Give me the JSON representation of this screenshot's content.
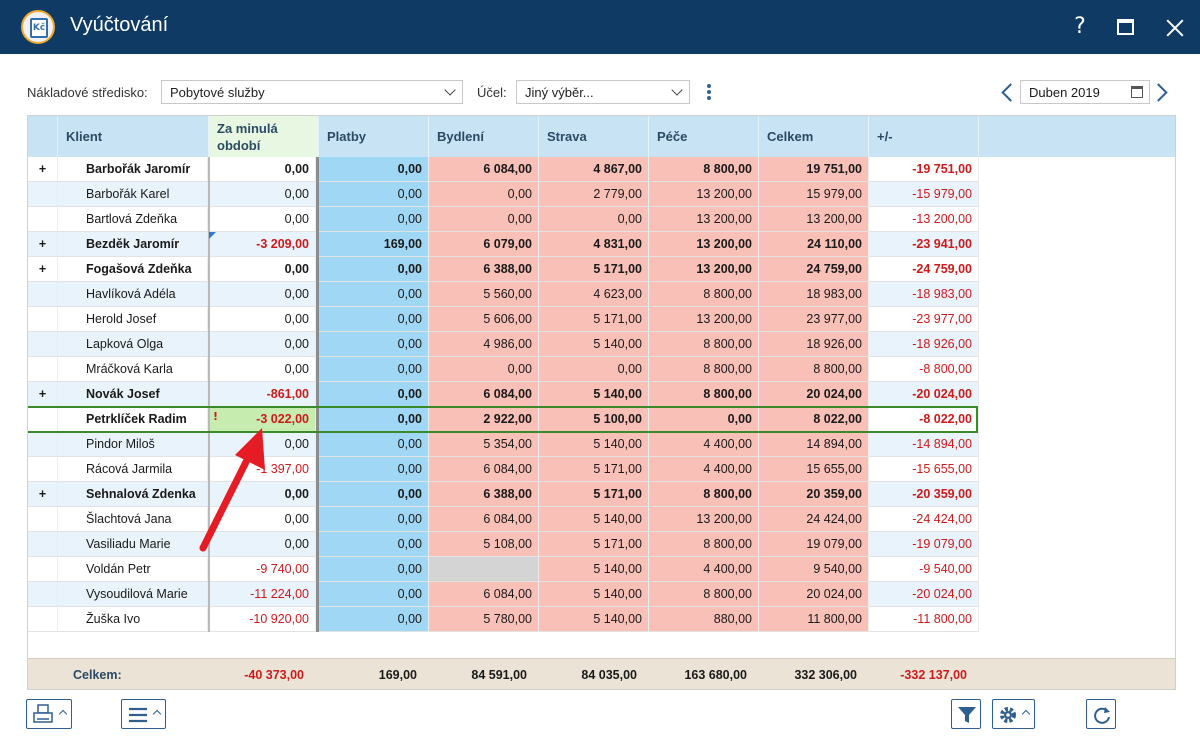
{
  "window": {
    "title": "Vyúčtování",
    "app_icon": "Kč",
    "help_label": "?"
  },
  "filters": {
    "cost_center_label": "Nákladové středisko:",
    "cost_center_value": "Pobytové služby",
    "purpose_label": "Účel:",
    "purpose_value": "Jiný výběr...",
    "period_value": "Duben 2019"
  },
  "table": {
    "columns": [
      "Klient",
      "Za minulá\nobdobí",
      "Platby",
      "Bydlení",
      "Strava",
      "Péče",
      "Celkem",
      "+/-"
    ],
    "rows": [
      {
        "expand": "+",
        "bold": true,
        "name": "Barbořák Jaromír",
        "prev": "0,00",
        "platby": "0,00",
        "bydleni": "6 084,00",
        "strava": "4 867,00",
        "pece": "8 800,00",
        "celkem": "19 751,00",
        "diff": "-19 751,00"
      },
      {
        "expand": "",
        "bold": false,
        "name": "Barbořák Karel",
        "prev": "0,00",
        "platby": "0,00",
        "bydleni": "0,00",
        "strava": "2 779,00",
        "pece": "13 200,00",
        "celkem": "15 979,00",
        "diff": "-15 979,00"
      },
      {
        "expand": "",
        "bold": false,
        "name": "Bartlová Zdeňka",
        "prev": "0,00",
        "platby": "0,00",
        "bydleni": "0,00",
        "strava": "0,00",
        "pece": "13 200,00",
        "celkem": "13 200,00",
        "diff": "-13 200,00"
      },
      {
        "expand": "+",
        "bold": true,
        "name": "Bezděk Jaromír",
        "prev": "-3 209,00",
        "platby": "169,00",
        "bydleni": "6 079,00",
        "strava": "4 831,00",
        "pece": "13 200,00",
        "celkem": "24 110,00",
        "diff": "-23 941,00"
      },
      {
        "expand": "+",
        "bold": true,
        "name": "Fogašová Zdeňka",
        "prev": "0,00",
        "platby": "0,00",
        "bydleni": "6 388,00",
        "strava": "5 171,00",
        "pece": "13 200,00",
        "celkem": "24 759,00",
        "diff": "-24 759,00"
      },
      {
        "expand": "",
        "bold": false,
        "name": "Havlíková Adéla",
        "prev": "0,00",
        "platby": "0,00",
        "bydleni": "5 560,00",
        "strava": "4 623,00",
        "pece": "8 800,00",
        "celkem": "18 983,00",
        "diff": "-18 983,00"
      },
      {
        "expand": "",
        "bold": false,
        "name": "Herold Josef",
        "prev": "0,00",
        "platby": "0,00",
        "bydleni": "5 606,00",
        "strava": "5 171,00",
        "pece": "13 200,00",
        "celkem": "23 977,00",
        "diff": "-23 977,00"
      },
      {
        "expand": "",
        "bold": false,
        "name": "Lapková Olga",
        "prev": "0,00",
        "platby": "0,00",
        "bydleni": "4 986,00",
        "strava": "5 140,00",
        "pece": "8 800,00",
        "celkem": "18 926,00",
        "diff": "-18 926,00"
      },
      {
        "expand": "",
        "bold": false,
        "name": "Mráčková Karla",
        "prev": "0,00",
        "platby": "0,00",
        "bydleni": "0,00",
        "strava": "0,00",
        "pece": "8 800,00",
        "celkem": "8 800,00",
        "diff": "-8 800,00"
      },
      {
        "expand": "+",
        "bold": true,
        "name": "Novák Josef",
        "prev": "-861,00",
        "platby": "0,00",
        "bydleni": "6 084,00",
        "strava": "5 140,00",
        "pece": "8 800,00",
        "celkem": "20 024,00",
        "diff": "-20 024,00"
      },
      {
        "expand": "",
        "bold": true,
        "name": "Petrklíček Radim",
        "prev": "-3 022,00",
        "platby": "0,00",
        "bydleni": "2 922,00",
        "strava": "5 100,00",
        "pece": "0,00",
        "celkem": "8 022,00",
        "diff": "-8 022,00",
        "flag": "!"
      },
      {
        "expand": "",
        "bold": false,
        "name": "Pindor Miloš",
        "prev": "0,00",
        "platby": "0,00",
        "bydleni": "5 354,00",
        "strava": "5 140,00",
        "pece": "4 400,00",
        "celkem": "14 894,00",
        "diff": "-14 894,00"
      },
      {
        "expand": "",
        "bold": false,
        "name": "Rácová Jarmila",
        "prev": "-1 397,00",
        "platby": "0,00",
        "bydleni": "6 084,00",
        "strava": "5 171,00",
        "pece": "4 400,00",
        "celkem": "15 655,00",
        "diff": "-15 655,00"
      },
      {
        "expand": "+",
        "bold": true,
        "name": "Sehnalová Zdenka",
        "prev": "0,00",
        "platby": "0,00",
        "bydleni": "6 388,00",
        "strava": "5 171,00",
        "pece": "8 800,00",
        "celkem": "20 359,00",
        "diff": "-20 359,00"
      },
      {
        "expand": "",
        "bold": false,
        "name": "Šlachtová Jana",
        "prev": "0,00",
        "platby": "0,00",
        "bydleni": "6 084,00",
        "strava": "5 140,00",
        "pece": "13 200,00",
        "celkem": "24 424,00",
        "diff": "-24 424,00"
      },
      {
        "expand": "",
        "bold": false,
        "name": "Vasiliadu Marie",
        "prev": "0,00",
        "platby": "0,00",
        "bydleni": "5 108,00",
        "strava": "5 171,00",
        "pece": "8 800,00",
        "celkem": "19 079,00",
        "diff": "-19 079,00"
      },
      {
        "expand": "",
        "bold": false,
        "name": "Voldán Petr",
        "prev": "-9 740,00",
        "platby": "0,00",
        "bydleni": "",
        "strava": "5 140,00",
        "pece": "4 400,00",
        "celkem": "9 540,00",
        "diff": "-9 540,00"
      },
      {
        "expand": "",
        "bold": false,
        "name": "Vysoudilová Marie",
        "prev": "-11 224,00",
        "platby": "0,00",
        "bydleni": "6 084,00",
        "strava": "5 140,00",
        "pece": "8 800,00",
        "celkem": "20 024,00",
        "diff": "-20 024,00"
      },
      {
        "expand": "",
        "bold": false,
        "name": "Žuška Ivo",
        "prev": "-10 920,00",
        "platby": "0,00",
        "bydleni": "5 780,00",
        "strava": "5 140,00",
        "pece": "880,00",
        "celkem": "11 800,00",
        "diff": "-11 800,00"
      }
    ],
    "totals": {
      "label": "Celkem:",
      "prev": "-40 373,00",
      "platby": "169,00",
      "bydleni": "84 591,00",
      "strava": "84 035,00",
      "pece": "163 680,00",
      "celkem": "332 306,00",
      "diff": "-332 137,00"
    }
  },
  "colors": {
    "titlebar": "#0f3a64",
    "header": "#c7e3f4",
    "payments": "#9fd7f5",
    "costs": "#f9c0b8",
    "negative": "#cc1a1a",
    "selected_border": "#3a8a2a",
    "annotation_arrow": "#e51c23"
  },
  "toolbar": {
    "print_icon": "printer-icon",
    "menu_icon": "hamburger-icon",
    "filter_icon": "funnel-icon",
    "settings_icon": "gear-icon",
    "refresh_icon": "refresh-icon"
  }
}
